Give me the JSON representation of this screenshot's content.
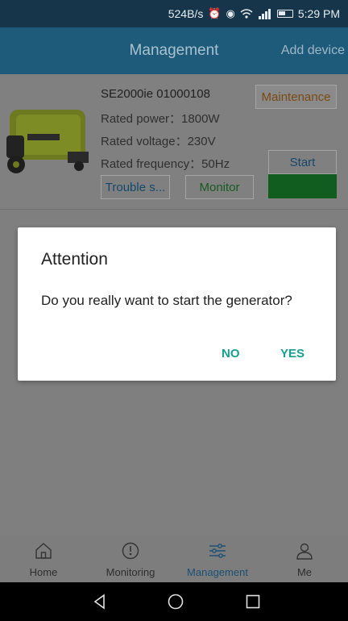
{
  "status_bar": {
    "speed": "524B/s",
    "time": "5:29 PM"
  },
  "header": {
    "title": "Management",
    "add_device": "Add device"
  },
  "device": {
    "name": "SE2000ie 01000108",
    "rated_power": "Rated power：1800W",
    "rated_voltage": "Rated voltage：230V",
    "rated_frequency": "Rated frequency：50Hz",
    "maintenance_label": "Maintenance",
    "start_label": "Start",
    "trouble_label": "Trouble s...",
    "monitor_label": "Monitor",
    "start_indicator_color": "#115d1f"
  },
  "dialog": {
    "title": "Attention",
    "message": "Do you really want to start the generator?",
    "no_label": "NO",
    "yes_label": "YES",
    "accent_color": "#16a090"
  },
  "tabs": [
    {
      "label": "Home",
      "icon": "home-icon"
    },
    {
      "label": "Monitoring",
      "icon": "gauge-icon"
    },
    {
      "label": "Management",
      "icon": "sliders-icon",
      "active": true
    },
    {
      "label": "Me",
      "icon": "person-icon"
    }
  ],
  "nav": [
    "back-icon",
    "home-circle-icon",
    "recents-icon"
  ]
}
